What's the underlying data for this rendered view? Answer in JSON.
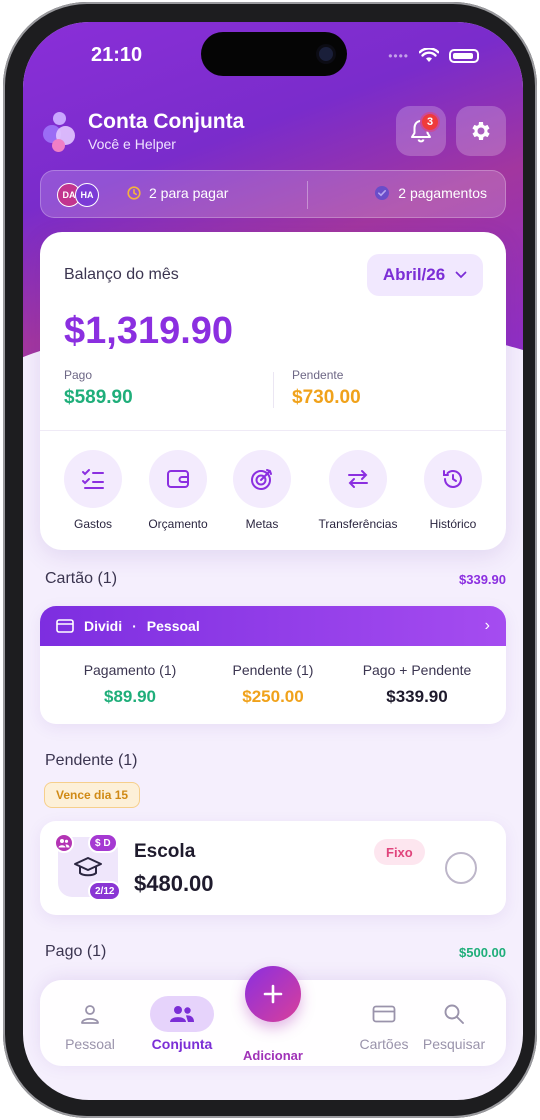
{
  "status": {
    "time": "21:10"
  },
  "header": {
    "title": "Conta Conjunta",
    "subtitle": "Você e Helper",
    "notification_count": "3"
  },
  "summary": {
    "avatars": [
      "DA",
      "HA"
    ],
    "to_pay": "2 para pagar",
    "payments": "2 pagamentos"
  },
  "balance": {
    "label": "Balanço do mês",
    "month": "Abril/26",
    "total": "$1,319.90",
    "paid_label": "Pago",
    "paid_value": "$589.90",
    "pending_label": "Pendente",
    "pending_value": "$730.00"
  },
  "actions": [
    {
      "label": "Gastos",
      "icon": "checklist-icon"
    },
    {
      "label": "Orçamento",
      "icon": "wallet-icon"
    },
    {
      "label": "Metas",
      "icon": "target-icon"
    },
    {
      "label": "Transferências",
      "icon": "transfer-arrows-icon"
    },
    {
      "label": "Histórico",
      "icon": "history-icon"
    }
  ],
  "card_section": {
    "title": "Cartão (1)",
    "amount": "$339.90",
    "card_name": "Dividi",
    "separator": "·",
    "card_type": "Pessoal",
    "columns": [
      {
        "label": "Pagamento (1)",
        "value": "$89.90"
      },
      {
        "label": "Pendente (1)",
        "value": "$250.00"
      },
      {
        "label": "Pago + Pendente",
        "value": "$339.90"
      }
    ]
  },
  "pending_section": {
    "title": "Pendente (1)",
    "due_chip": "Vence dia 15",
    "item": {
      "name": "Escola",
      "amount": "$480.00",
      "tag": "Fixo",
      "payer_badge": "$ D",
      "installment": "2/12",
      "icon": "graduation-cap-icon"
    }
  },
  "paid_section": {
    "title": "Pago (1)",
    "amount": "$500.00"
  },
  "tabbar": {
    "tabs": [
      {
        "label": "Pessoal",
        "icon": "person-icon"
      },
      {
        "label": "Conjunta",
        "icon": "group-icon",
        "active": true
      },
      {
        "label": "Cartões",
        "icon": "credit-card-icon"
      },
      {
        "label": "Pesquisar",
        "icon": "search-icon"
      }
    ],
    "add_label": "Adicionar"
  },
  "colors": {
    "accent": "#8b2fe0",
    "paid": "#1fae7a",
    "pending": "#f0a21b",
    "hero_start": "#8a2fd8",
    "hero_mid": "#a2369f"
  }
}
